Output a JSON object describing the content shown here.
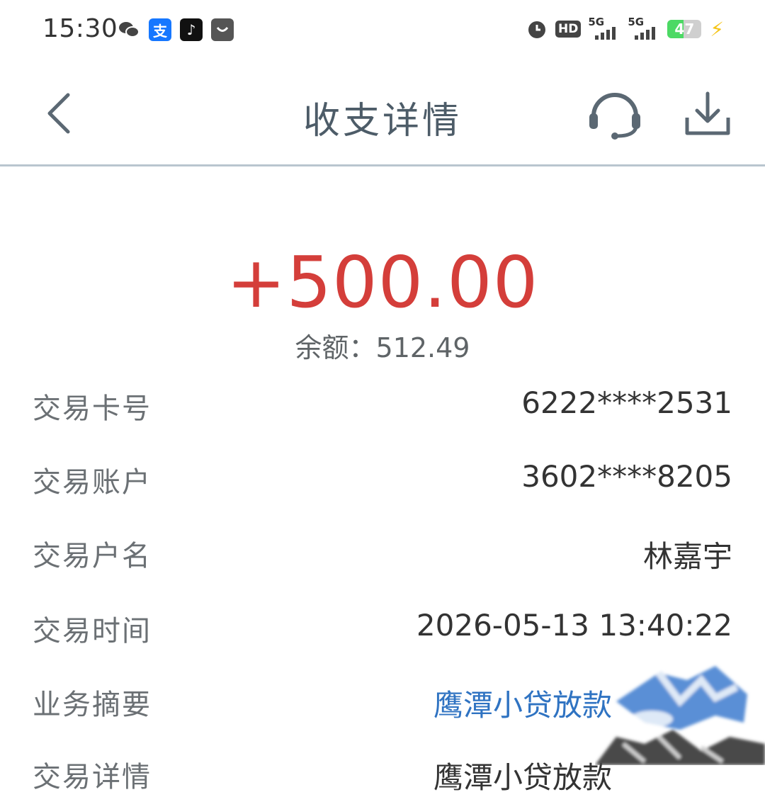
{
  "status_bar": {
    "time": "15:30",
    "apps": [
      {
        "icon": "wechat-icon",
        "glyph": "✿",
        "bg": "#ffffff",
        "fg": "#333333"
      },
      {
        "icon": "alipay-icon",
        "glyph": "支",
        "bg": "#1677ff",
        "fg": "#ffffff"
      },
      {
        "icon": "tiktok-icon",
        "glyph": "♪",
        "bg": "#111111",
        "fg": "#ffffff"
      },
      {
        "icon": "message-icon",
        "glyph": "◡",
        "bg": "#555555",
        "fg": "#ffffff"
      }
    ],
    "hd_label": "HD",
    "network_1": "5G",
    "network_2": "5G",
    "battery_level": "47",
    "battery_fraction": 0.47
  },
  "header": {
    "title": "收支详情"
  },
  "transaction": {
    "amount": "+500.00",
    "balance": "余额：512.49"
  },
  "rows": [
    {
      "label": "交易卡号",
      "value": "6222****2531"
    },
    {
      "label": "交易账户",
      "value": "3602****8205"
    },
    {
      "label": "交易户名",
      "value": "林嘉宇"
    },
    {
      "label": "交易时间",
      "value": "2026-05-13 13:40:22"
    },
    {
      "label": "业务摘要",
      "value": "鹰潭小贷放款"
    },
    {
      "label": "交易详情",
      "value": "鹰潭小贷放款"
    }
  ],
  "colors": {
    "amount": "#d43e3a",
    "link": "#2f73c2",
    "header_text": "#4d5c68",
    "divider": "#b9c6cf"
  }
}
